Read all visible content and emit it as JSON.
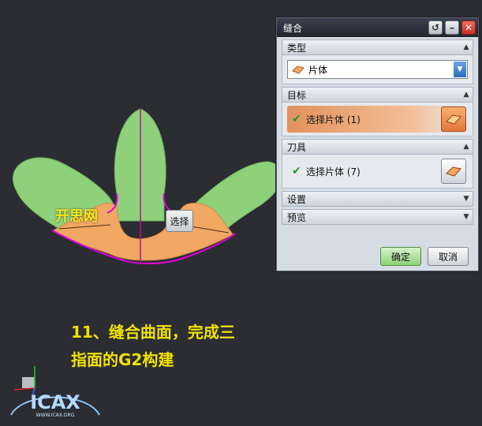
{
  "viewport": {
    "brand_text": "开思网",
    "tooltip_label": "选择",
    "caption_line1": "11、缝合曲面，完成三",
    "caption_line2": "指面的G2构建",
    "logo_text": "ICAX",
    "logo_subtext": "WWW.ICAX.ORG"
  },
  "dialog": {
    "title": "缝合",
    "titlebar_buttons": {
      "reset": "↺",
      "minimize": "–",
      "close": "✕"
    },
    "sections": {
      "type": {
        "label": "类型",
        "selected": "片体"
      },
      "target": {
        "label": "目标",
        "pick_label": "选择片体 (1)"
      },
      "tool": {
        "label": "刀具",
        "pick_label": "选择片体 (7)"
      },
      "settings": {
        "label": "设置"
      },
      "preview": {
        "label": "预览"
      }
    },
    "buttons": {
      "ok": "确定",
      "cancel": "取消"
    }
  },
  "colors": {
    "background": "#2b2d32",
    "surface_green": "#8fd07a",
    "surface_orange": "#f0a864",
    "edge_magenta": "#e000e0",
    "caption_yellow": "#f2e200"
  }
}
